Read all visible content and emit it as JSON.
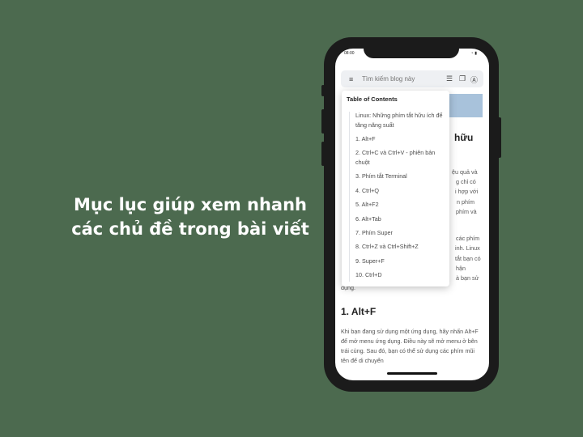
{
  "caption": {
    "line1": "Mục lục giúp xem nhanh",
    "line2": "các chủ đề trong bài viết"
  },
  "status": {
    "time": "08:00",
    "icons": "wifi battery"
  },
  "search": {
    "placeholder": "Tìm kiếm blog này"
  },
  "icons": [
    "menu-icon",
    "list-icon",
    "bookmark-icon",
    "text-search-icon",
    "wifi-icon",
    "battery-icon"
  ],
  "toc": {
    "title": "Table of Contents",
    "items": [
      "Linux: Những phím tắt hữu ích để tăng năng suất",
      "1. Alt+F",
      "2. Ctrl+C và Ctrl+V - phiên bản chuột",
      "3. Phím tắt Terminal",
      "4. Ctrl+Q",
      "5. Alt+F2",
      "6. Alt+Tab",
      "7. Phím Super",
      "8. Ctrl+Z và Ctrl+Shift+Z",
      "9. Super+F",
      "10. Ctrl+D"
    ]
  },
  "article": {
    "fragments": [
      "hữu",
      "ệu quả và",
      "g chỉ có",
      "i hợp với",
      "n phím",
      "phím và",
      "các phím",
      "inh. Linux",
      "tắt bạn có",
      "hận",
      "à bạn sử",
      "dụng."
    ],
    "heading": "1. Alt+F",
    "paragraph": "Khi bạn đang sử dụng một ứng dụng, hãy nhấn Alt+F để mở menu ứng dụng. Điều này sẽ mở menu ở bên trái cùng. Sau đó, bạn có thể sử dụng các phím mũi tên để di chuyển"
  }
}
